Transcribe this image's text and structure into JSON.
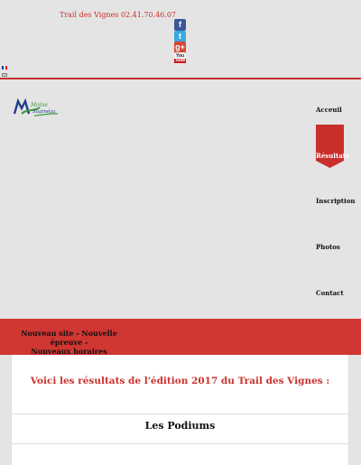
{
  "header": {
    "phone_text": "Trail des Vignes 02.41.70.46.07",
    "social": [
      {
        "name": "facebook-icon",
        "glyph": "f"
      },
      {
        "name": "twitter-icon",
        "glyph": "t"
      },
      {
        "name": "google-plus-icon",
        "glyph": "g+"
      },
      {
        "name": "youtube-icon",
        "glyph_top": "You",
        "glyph_bottom": "Tube"
      }
    ],
    "accent_color": "#c9302c"
  },
  "logo": {
    "text_top": "Moine",
    "text_bottom": "Saginéza"
  },
  "nav": {
    "items": [
      {
        "label": "Acceuil"
      },
      {
        "label": "Résultats",
        "active": true
      },
      {
        "label": "Inscription"
      },
      {
        "label": "Photos"
      },
      {
        "label": "Contact"
      }
    ]
  },
  "banner": {
    "line1": "Nouveau site - Nouvelle épreuve -",
    "line2": "Nouveaux horaires",
    "color": "#d03632"
  },
  "content": {
    "results_heading": "Voici les résultats de l'édition 2017 du Trail des Vignes :",
    "podiums_heading": "Les Podiums"
  }
}
